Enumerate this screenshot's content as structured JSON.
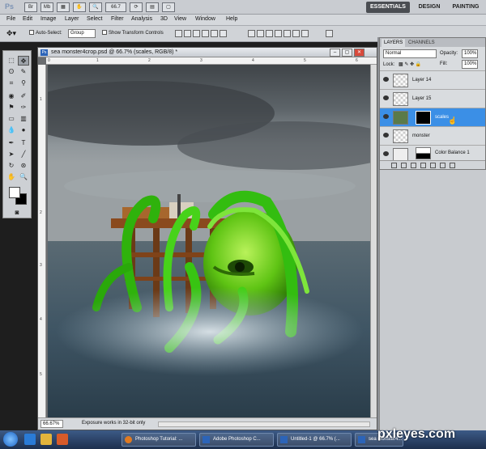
{
  "appbar": {
    "logo": "Ps",
    "zoom_value": "66.7",
    "workspaces": [
      "ESSENTIALS",
      "DESIGN",
      "PAINTING"
    ]
  },
  "menubar": {
    "items": [
      "File",
      "Edit",
      "Image",
      "Layer",
      "Select",
      "Filter",
      "Analysis",
      "3D",
      "View",
      "Window",
      "Help"
    ]
  },
  "options": {
    "auto_select_label": "Auto-Select:",
    "auto_select_value": "Group",
    "transform_label": "Show Transform Controls"
  },
  "document": {
    "title": "sea monster4crop.psd @ 66.7% (scales, RGB/8) *",
    "ps_badge": "Ps",
    "ruler_top_ticks": [
      "0",
      "1",
      "2",
      "3",
      "4",
      "5",
      "6"
    ],
    "ruler_left_ticks": [
      "1",
      "2",
      "3",
      "4",
      "5"
    ],
    "zoom": "66.67%",
    "status": "Exposure works in 32-bit only"
  },
  "layers": {
    "tabs": [
      "LAYERS",
      "CHANNELS"
    ],
    "blend_mode": "Normal",
    "opacity_label": "Opacity:",
    "opacity_value": "100%",
    "lock_label": "Lock:",
    "fill_label": "Fill:",
    "fill_value": "100%",
    "rows": [
      {
        "name": "Layer 14",
        "selected": false
      },
      {
        "name": "Layer 15",
        "selected": false
      },
      {
        "name": "scales",
        "selected": true
      },
      {
        "name": "monster",
        "selected": false
      },
      {
        "name": "Color Balance 1",
        "selected": false
      }
    ]
  },
  "taskbar": {
    "tasks": [
      "Photoshop Tutorial: ...",
      "Adobe Photoshop C...",
      "Untitled-1 @ 66.7% (...",
      "sea monster4..."
    ]
  },
  "watermark": "pxleyes.com",
  "colors": {
    "selection_blue": "#3b8fe6",
    "monster_green": "#6fd21e",
    "sky_dark": "#5f666b"
  }
}
